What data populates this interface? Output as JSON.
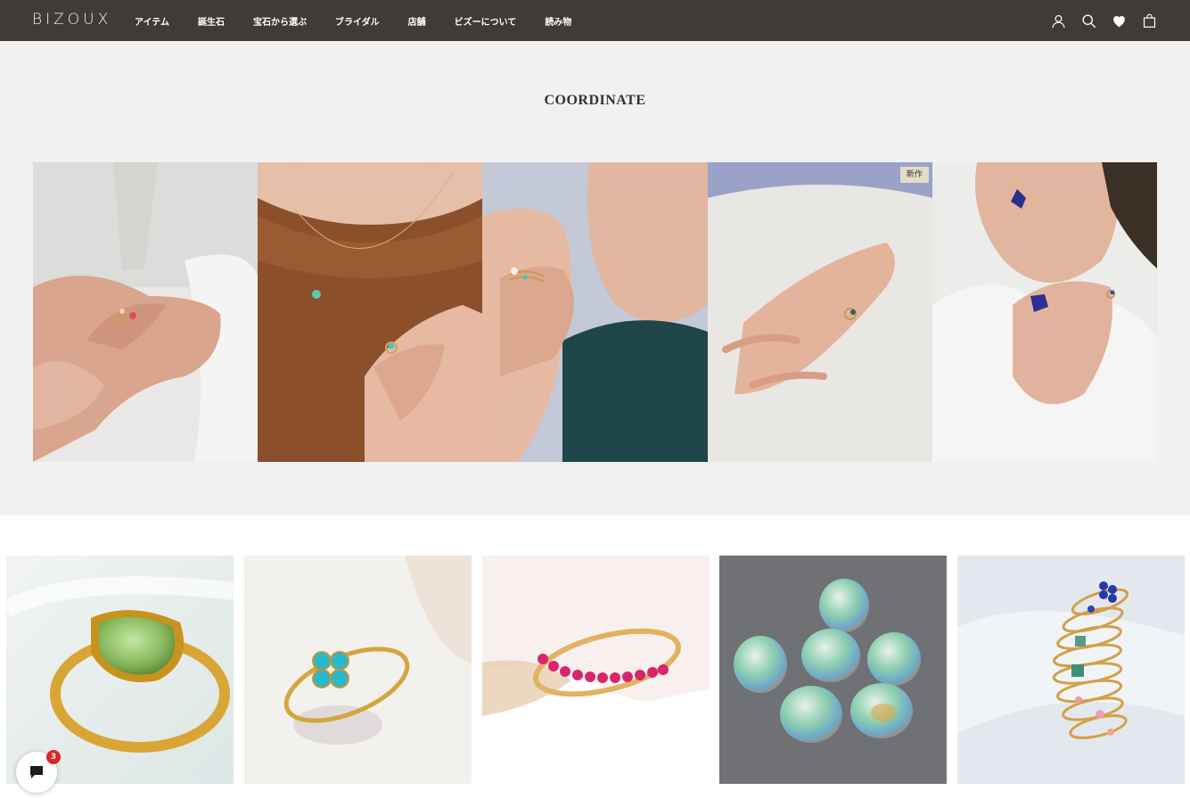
{
  "header": {
    "logo": "BIZOUX",
    "nav": [
      "アイテム",
      "誕生石",
      "宝石から選ぶ",
      "ブライダル",
      "店舗",
      "ビズーについて",
      "読み物"
    ],
    "icons": [
      "account-icon",
      "search-icon",
      "heart-icon",
      "bag-icon"
    ]
  },
  "coordinate": {
    "title": "COORDINATE",
    "badge": "新作",
    "photos": [
      "ring-on-lace-sleeve-hand",
      "necklace-and-ring-brown-blouse",
      "layered-rings-hand-at-cheek",
      "ring-hand-on-white-fabric",
      "earring-and-rings-white-top"
    ]
  },
  "products": [
    "green-pear-stone-gold-ring",
    "paraiba-flower-ring",
    "ruby-eternity-band",
    "loose-opal-stones",
    "stacked-gemstone-rings"
  ],
  "chat": {
    "count": "3",
    "icon": "chat-bubble-icon"
  },
  "colors": {
    "header_bg": "#403b37",
    "section_bg": "#f0f1f0",
    "badge_bg": "#e3ddc5",
    "chat_badge": "#e02424"
  }
}
